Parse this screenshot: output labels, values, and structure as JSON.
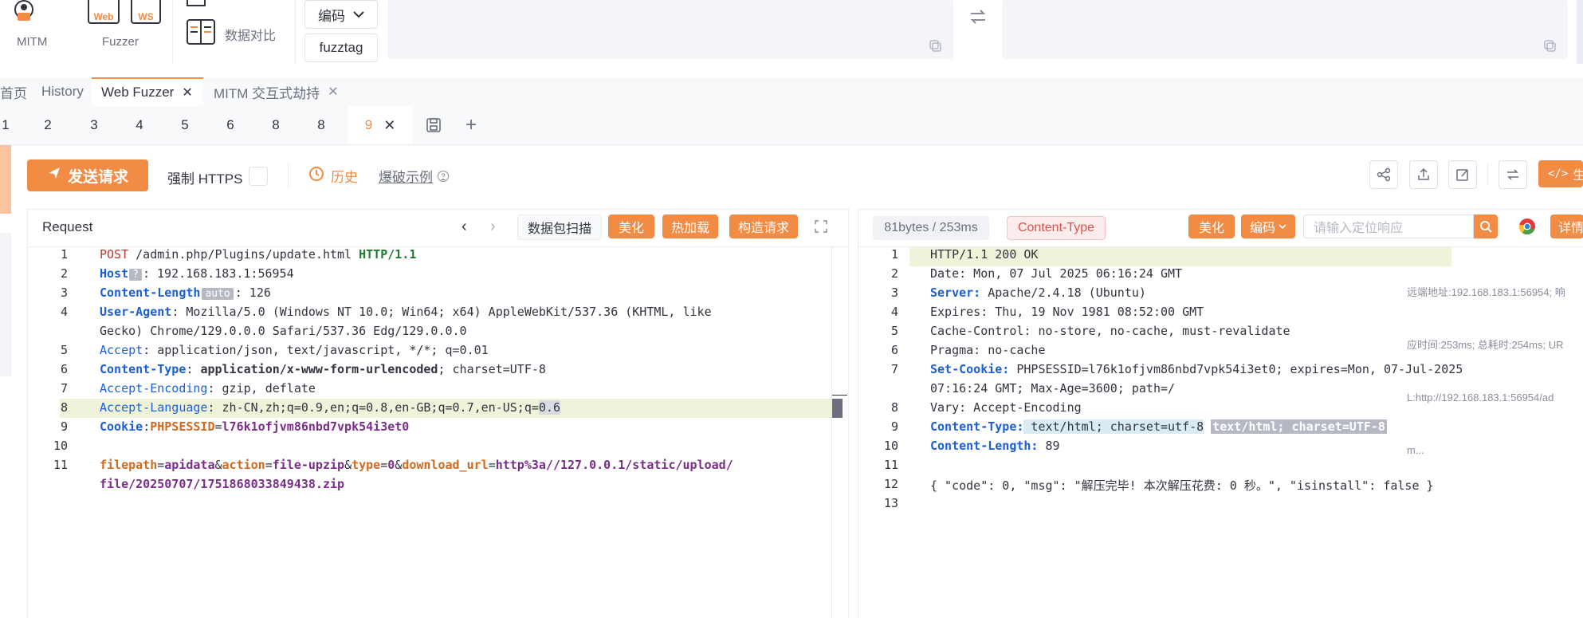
{
  "toolbar": {
    "mitm_label": "MITM",
    "fuzzer_label": "Fuzzer",
    "fuzzer_web": "Web",
    "fuzzer_ws": "WS",
    "compare_label": "数据对比",
    "encode_select": "编码",
    "fuzztag_label": "fuzztag"
  },
  "tabs_main": [
    {
      "label": "首页"
    },
    {
      "label": "History"
    },
    {
      "label": "Web Fuzzer"
    },
    {
      "label": "MITM 交互式劫持"
    }
  ],
  "tabs_fuzzer": [
    {
      "label": "1"
    },
    {
      "label": "2"
    },
    {
      "label": "3"
    },
    {
      "label": "4"
    },
    {
      "label": "5"
    },
    {
      "label": "6"
    },
    {
      "label": "8"
    },
    {
      "label": "8"
    },
    {
      "label": "9"
    }
  ],
  "actions": {
    "send_label": "发送请求",
    "force_https": "强制 HTTPS",
    "history": "历史",
    "blast_example": "爆破示例",
    "generate_label": "生"
  },
  "request": {
    "title": "Request",
    "scan_label": "数据包扫描",
    "beautify": "美化",
    "hot_load": "热加载",
    "construct": "构造请求",
    "host_badge": "?",
    "auto_badge": "auto",
    "lines": [
      {
        "n": "1",
        "method": "POST",
        "path": " /admin.php/Plugins/update.html ",
        "proto": "HTTP/1.1"
      },
      {
        "n": "2",
        "key": "Host",
        "val": ": 192.168.183.1:56954"
      },
      {
        "n": "3",
        "key": "Content-Length",
        "val": ": 126"
      },
      {
        "n": "4",
        "key": "User-Agent",
        "val": ": Mozilla/5.0 (Windows NT 10.0; Win64; x64) AppleWebKit/537.36 (KHTML, like",
        "cont": "Gecko) Chrome/129.0.0.0 Safari/537.36 Edg/129.0.0.0"
      },
      {
        "n": "5",
        "key": "Accept",
        "val": ": application/json, text/javascript, */*; q=0.01"
      },
      {
        "n": "6",
        "key": "Content-Type",
        "val_bold": "application/x-www-form-urlencoded",
        "val": "; charset=UTF-8"
      },
      {
        "n": "7",
        "key": "Accept-Encoding",
        "val": ": gzip, deflate"
      },
      {
        "n": "8",
        "key": "Accept-Language",
        "val": ": zh-CN,zh;q=0.9,en;q=0.8,en-GB;q=0.7,en-US;q=",
        "val_end": "0.6"
      },
      {
        "n": "9",
        "key": "Cookie",
        "ck": "PHPSESSID",
        "cv": "l76k1ofjvm86nbd7vpk54i3et0"
      },
      {
        "n": "10"
      },
      {
        "n": "11",
        "body1": "filepath",
        "body2": "apidata",
        "body3": "action",
        "body4": "file-upzip",
        "body5": "type",
        "body6": "0",
        "body7": "download_url",
        "body8": "http%3a//127.0.0.1/static/upload/",
        "cont": "file/20250707/1751868033849438.zip"
      }
    ]
  },
  "response": {
    "size": "81bytes / 253ms",
    "content_type_tag": "Content-Type",
    "beautify": "美化",
    "encode": "编码",
    "search_placeholder": "请输入定位响应",
    "detail_label": "详情",
    "meta_line1": "远端地址:192.168.183.1:56954; 响",
    "meta_line2": "应时间:253ms; 总耗时:254ms; UR",
    "meta_line3": "L:http://192.168.183.1:56954/ad",
    "meta_line4": "m...",
    "lines": [
      {
        "n": "1",
        "text": "HTTP/1.1 200 OK"
      },
      {
        "n": "2",
        "text": "Date: Mon, 07 Jul 2025 06:16:24 GMT"
      },
      {
        "n": "3",
        "key": "Server:",
        "val": " Apache/2.4.18 (Ubuntu)"
      },
      {
        "n": "4",
        "text": "Expires: Thu, 19 Nov 1981 08:52:00 GMT"
      },
      {
        "n": "5",
        "text": "Cache-Control: no-store, no-cache, must-revalidate"
      },
      {
        "n": "6",
        "text": "Pragma: no-cache"
      },
      {
        "n": "7",
        "key": "Set-Cookie:",
        "val": " PHPSESSID=l76k1ofjvm86nbd7vpk54i3et0; expires=Mon, 07-Jul-2025",
        "cont": "07:16:24 GMT; Max-Age=3600; path=/"
      },
      {
        "n": "8",
        "text": "Vary: Accept-Encoding"
      },
      {
        "n": "9",
        "key": "Content-Type:",
        "val": " text/html; charset=utf-8",
        "badge": "text/html; charset=UTF-8"
      },
      {
        "n": "10",
        "key": "Content-Length:",
        "val": " 89"
      },
      {
        "n": "11"
      },
      {
        "n": "12",
        "text": "{ \"code\": 0, \"msg\": \"解压完毕! 本次解压花费: 0 秒。\", \"isinstall\": false }"
      },
      {
        "n": "13"
      }
    ]
  }
}
